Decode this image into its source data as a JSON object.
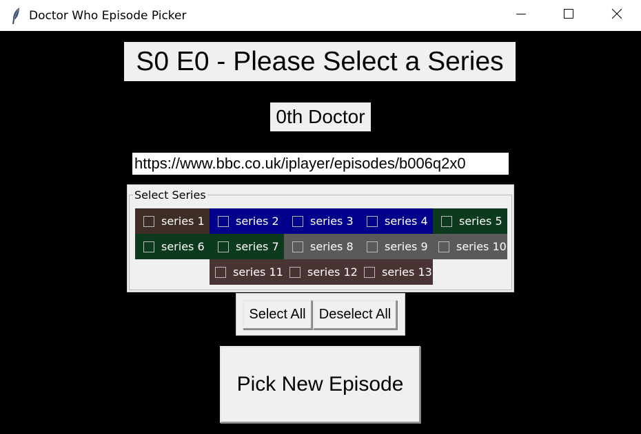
{
  "window": {
    "title": "Doctor Who Episode Picker",
    "icon": "feather-icon"
  },
  "header": {
    "episode_title": "S0 E0 - Please Select a Series",
    "doctor": "0th Doctor"
  },
  "url_field": {
    "value": "https://www.bbc.co.uk/iplayer/episodes/b006q2x0"
  },
  "series_group": {
    "legend": "Select Series",
    "items": [
      {
        "label": "series 1",
        "color": "#3e2d24",
        "checked": false
      },
      {
        "label": "series 2",
        "color": "#00008b",
        "checked": false
      },
      {
        "label": "series 3",
        "color": "#00008b",
        "checked": false
      },
      {
        "label": "series 4",
        "color": "#00008b",
        "checked": false
      },
      {
        "label": "series 5",
        "color": "#0b3b1c",
        "checked": false
      },
      {
        "label": "series 6",
        "color": "#0b3b1c",
        "checked": false
      },
      {
        "label": "series 7",
        "color": "#0b3b1c",
        "checked": false
      },
      {
        "label": "series 8",
        "color": "#5a5a5a",
        "checked": false
      },
      {
        "label": "series 9",
        "color": "#5a5a5a",
        "checked": false
      },
      {
        "label": "series 10",
        "color": "#5a5a5a",
        "checked": false
      },
      {
        "label": "series 11",
        "color": "#4a3333",
        "checked": false
      },
      {
        "label": "series 12",
        "color": "#4a3333",
        "checked": false
      },
      {
        "label": "series 13",
        "color": "#4a3333",
        "checked": false
      }
    ]
  },
  "buttons": {
    "select_all": "Select All",
    "deselect_all": "Deselect All",
    "pick": "Pick New Episode"
  }
}
